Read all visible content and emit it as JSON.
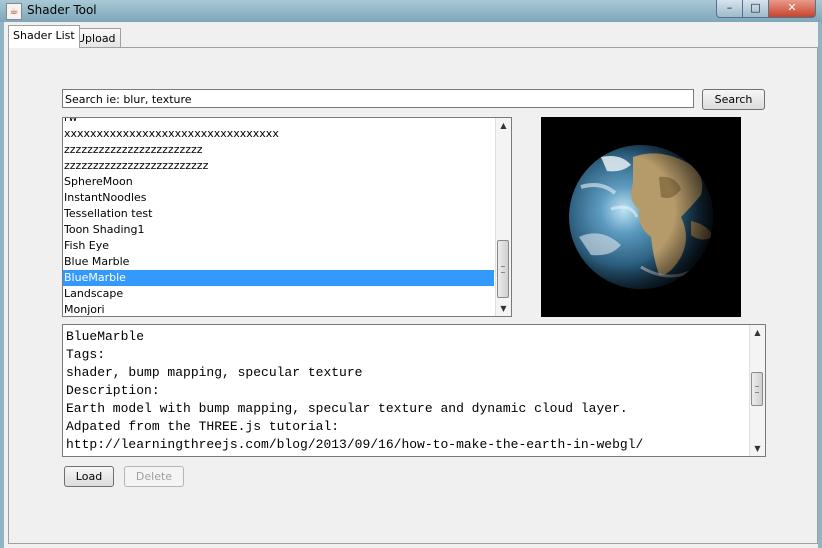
{
  "window": {
    "title": "Shader Tool",
    "close_glyph": "✕",
    "min_glyph": "–",
    "max_glyph": "□",
    "app_icon": "java-cup-icon"
  },
  "tabs": [
    {
      "label": "Shader List",
      "active": true
    },
    {
      "label": "Upload",
      "active": false
    }
  ],
  "search": {
    "value": "Search ie: blur, texture",
    "button_label": "Search"
  },
  "shader_list": {
    "items": [
      "rw",
      "xxxxxxxxxxxxxxxxxxxxxxxxxxxxxxxxx",
      "zzzzzzzzzzzzzzzzzzzzzzzz",
      "zzzzzzzzzzzzzzzzzzzzzzzzz",
      "SphereMoon",
      "InstantNoodles",
      "Tessellation test",
      "Toon Shading1",
      "Fish Eye",
      "Blue Marble",
      "BlueMarble",
      "Landscape",
      "Monjori"
    ],
    "selected_index": 10,
    "scroll_up_glyph": "▲",
    "scroll_down_glyph": "▼"
  },
  "preview": {
    "icon": "earth-render-preview"
  },
  "details": {
    "lines": [
      "BlueMarble",
      "Tags:",
      "shader, bump mapping, specular texture",
      "Description:",
      "Earth model with bump mapping, specular texture and dynamic cloud layer.",
      "Adpated from the THREE.js tutorial:",
      "http://learningthreejs.com/blog/2013/09/16/how-to-make-the-earth-in-webgl/"
    ]
  },
  "actions": {
    "load_label": "Load",
    "delete_label": "Delete",
    "delete_enabled": false
  },
  "colors": {
    "selection": "#3399ff",
    "window_bg": "#f0f0f0"
  }
}
